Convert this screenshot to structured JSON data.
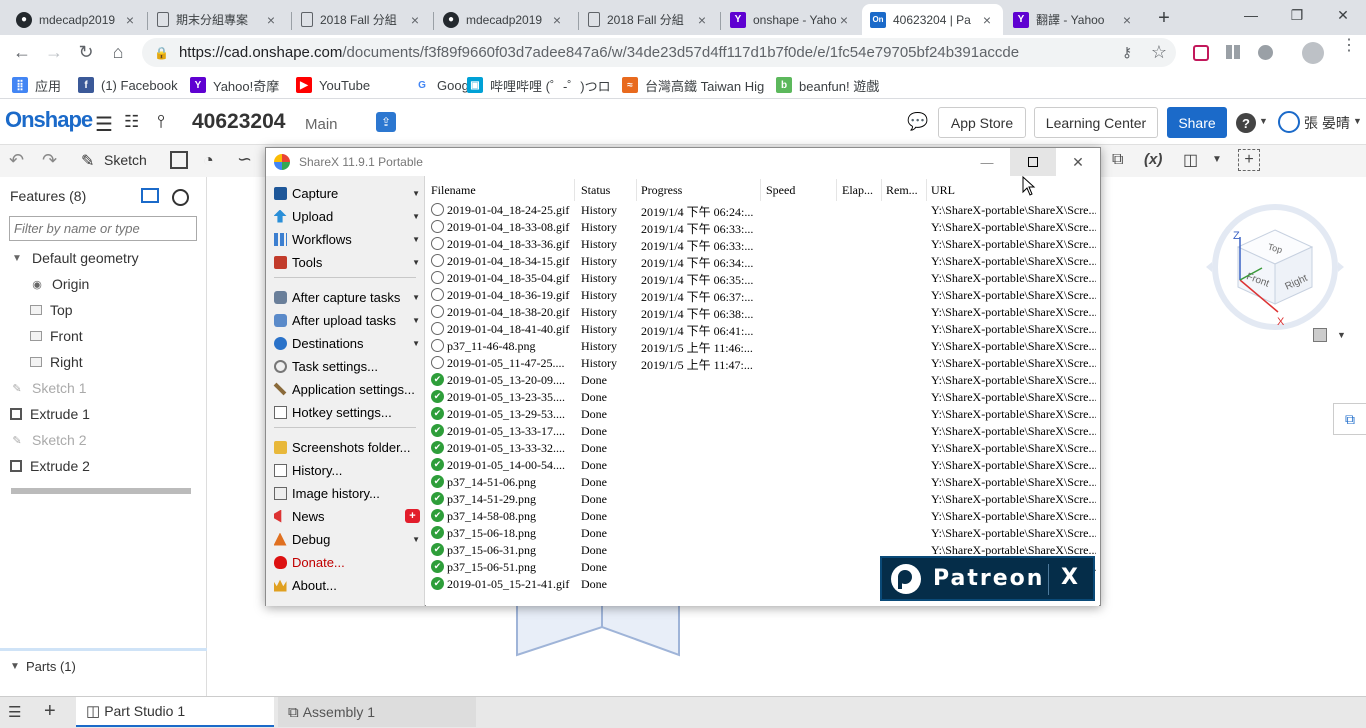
{
  "browser": {
    "tabs": [
      {
        "title": "mdecadp2019",
        "icon": "github-icon",
        "active": false
      },
      {
        "title": "期末分組專案",
        "icon": "doc-icon",
        "active": false
      },
      {
        "title": "2018 Fall 分組",
        "icon": "doc-icon",
        "active": false
      },
      {
        "title": "mdecadp2019",
        "icon": "github-icon",
        "active": false
      },
      {
        "title": "2018 Fall 分組",
        "icon": "doc-icon",
        "active": false
      },
      {
        "title": "onshape - Yahoo",
        "icon": "yahoo-icon",
        "active": false
      },
      {
        "title": "40623204 | Pa",
        "icon": "onshape-icon",
        "active": true
      },
      {
        "title": "翻譯 - Yahoo",
        "icon": "yahoo-icon",
        "active": false
      }
    ],
    "url_host": "https://cad.onshape.com",
    "url_path": "/documents/f3f89f9660f03d7adee847a6/w/34de23d57d4ff117d1b7f0de/e/1fc54e79705bf24b391accde",
    "bookmarks": [
      "应用",
      "(1) Facebook",
      "Yahoo!奇摩",
      "YouTube",
      "Google",
      "哔哩哔哩 (゜-゜)つロ",
      "台灣高鐵 Taiwan Hig",
      "beanfun! 遊戲"
    ]
  },
  "onshape": {
    "logo": "Onshape",
    "doc_name": "40623204",
    "branch": "Main",
    "app_store": "App Store",
    "learning_center": "Learning Center",
    "share": "Share",
    "user": "張 晏晴",
    "sketch": "Sketch",
    "fx": "(x)",
    "features_title": "Features (8)",
    "filter_placeholder": "Filter by name or type",
    "features": [
      {
        "label": "Default geometry",
        "icon": "chevron-down-icon",
        "indent": 0,
        "muted": false
      },
      {
        "label": "Origin",
        "icon": "origin-icon",
        "indent": 2,
        "muted": false
      },
      {
        "label": "Top",
        "icon": "plane-icon",
        "indent": 2,
        "muted": false
      },
      {
        "label": "Front",
        "icon": "plane-icon",
        "indent": 2,
        "muted": false
      },
      {
        "label": "Right",
        "icon": "plane-icon",
        "indent": 2,
        "muted": false
      },
      {
        "label": "Sketch 1",
        "icon": "sketch-icon",
        "indent": 1,
        "muted": true
      },
      {
        "label": "Extrude 1",
        "icon": "extrude-icon",
        "indent": 1,
        "muted": false
      },
      {
        "label": "Sketch 2",
        "icon": "sketch-icon",
        "indent": 1,
        "muted": true
      },
      {
        "label": "Extrude 2",
        "icon": "extrude-icon",
        "indent": 1,
        "muted": false
      }
    ],
    "parts": "Parts (1)",
    "tabs_bottom": [
      "Part Studio 1",
      "Assembly 1"
    ],
    "viewcube": {
      "top": "Top",
      "front": "Front",
      "right": "Right",
      "z": "Z",
      "x": "X"
    }
  },
  "sharex": {
    "title": "ShareX 11.9.1 Portable",
    "menu": [
      {
        "label": "Capture",
        "icon": "capture-icon",
        "arrow": true,
        "color": "#000"
      },
      {
        "label": "Upload",
        "icon": "upload-icon",
        "arrow": true,
        "color": "#000"
      },
      {
        "label": "Workflows",
        "icon": "workflows-icon",
        "arrow": true,
        "color": "#000"
      },
      {
        "label": "Tools",
        "icon": "tools-icon",
        "arrow": true,
        "color": "#000"
      },
      {
        "label": "After capture tasks",
        "icon": "after-capture-icon",
        "arrow": true,
        "color": "#000"
      },
      {
        "label": "After upload tasks",
        "icon": "after-upload-icon",
        "arrow": true,
        "color": "#000"
      },
      {
        "label": "Destinations",
        "icon": "destinations-icon",
        "arrow": true,
        "color": "#000"
      },
      {
        "label": "Task settings...",
        "icon": "task-settings-icon",
        "arrow": false,
        "color": "#000"
      },
      {
        "label": "Application settings...",
        "icon": "app-settings-icon",
        "arrow": false,
        "color": "#000"
      },
      {
        "label": "Hotkey settings...",
        "icon": "hotkey-icon",
        "arrow": false,
        "color": "#000"
      },
      {
        "label": "Screenshots folder...",
        "icon": "folder-icon",
        "arrow": false,
        "color": "#000"
      },
      {
        "label": "History...",
        "icon": "history-icon",
        "arrow": false,
        "color": "#000"
      },
      {
        "label": "Image history...",
        "icon": "image-history-icon",
        "arrow": false,
        "color": "#000"
      },
      {
        "label": "News",
        "icon": "news-icon",
        "arrow": false,
        "badge": "+",
        "color": "#000"
      },
      {
        "label": "Debug",
        "icon": "debug-icon",
        "arrow": true,
        "color": "#000"
      },
      {
        "label": "Donate...",
        "icon": "heart-icon",
        "arrow": false,
        "color": "#c00000"
      },
      {
        "label": "About...",
        "icon": "crown-icon",
        "arrow": false,
        "color": "#000"
      }
    ],
    "columns": [
      "Filename",
      "Status",
      "Progress",
      "Speed",
      "Elap...",
      "Rem...",
      "URL"
    ],
    "rows": [
      {
        "file": "2019-01-04_18-24-25.gif",
        "status": "History",
        "progress": "2019/1/4 下午 06:24:...",
        "url": "Y:\\ShareX-portable\\ShareX\\Scre...",
        "type": "hist"
      },
      {
        "file": "2019-01-04_18-33-08.gif",
        "status": "History",
        "progress": "2019/1/4 下午 06:33:...",
        "url": "Y:\\ShareX-portable\\ShareX\\Scre...",
        "type": "hist"
      },
      {
        "file": "2019-01-04_18-33-36.gif",
        "status": "History",
        "progress": "2019/1/4 下午 06:33:...",
        "url": "Y:\\ShareX-portable\\ShareX\\Scre...",
        "type": "hist"
      },
      {
        "file": "2019-01-04_18-34-15.gif",
        "status": "History",
        "progress": "2019/1/4 下午 06:34:...",
        "url": "Y:\\ShareX-portable\\ShareX\\Scre...",
        "type": "hist"
      },
      {
        "file": "2019-01-04_18-35-04.gif",
        "status": "History",
        "progress": "2019/1/4 下午 06:35:...",
        "url": "Y:\\ShareX-portable\\ShareX\\Scre...",
        "type": "hist"
      },
      {
        "file": "2019-01-04_18-36-19.gif",
        "status": "History",
        "progress": "2019/1/4 下午 06:37:...",
        "url": "Y:\\ShareX-portable\\ShareX\\Scre...",
        "type": "hist"
      },
      {
        "file": "2019-01-04_18-38-20.gif",
        "status": "History",
        "progress": "2019/1/4 下午 06:38:...",
        "url": "Y:\\ShareX-portable\\ShareX\\Scre...",
        "type": "hist"
      },
      {
        "file": "2019-01-04_18-41-40.gif",
        "status": "History",
        "progress": "2019/1/4 下午 06:41:...",
        "url": "Y:\\ShareX-portable\\ShareX\\Scre...",
        "type": "hist"
      },
      {
        "file": "p37_11-46-48.png",
        "status": "History",
        "progress": "2019/1/5 上午 11:46:...",
        "url": "Y:\\ShareX-portable\\ShareX\\Scre...",
        "type": "hist"
      },
      {
        "file": "2019-01-05_11-47-25....",
        "status": "History",
        "progress": "2019/1/5 上午 11:47:...",
        "url": "Y:\\ShareX-portable\\ShareX\\Scre...",
        "type": "hist"
      },
      {
        "file": "2019-01-05_13-20-09....",
        "status": "Done",
        "progress": "",
        "url": "Y:\\ShareX-portable\\ShareX\\Scre...",
        "type": "done"
      },
      {
        "file": "2019-01-05_13-23-35....",
        "status": "Done",
        "progress": "",
        "url": "Y:\\ShareX-portable\\ShareX\\Scre...",
        "type": "done"
      },
      {
        "file": "2019-01-05_13-29-53....",
        "status": "Done",
        "progress": "",
        "url": "Y:\\ShareX-portable\\ShareX\\Scre...",
        "type": "done"
      },
      {
        "file": "2019-01-05_13-33-17....",
        "status": "Done",
        "progress": "",
        "url": "Y:\\ShareX-portable\\ShareX\\Scre...",
        "type": "done"
      },
      {
        "file": "2019-01-05_13-33-32....",
        "status": "Done",
        "progress": "",
        "url": "Y:\\ShareX-portable\\ShareX\\Scre...",
        "type": "done"
      },
      {
        "file": "2019-01-05_14-00-54....",
        "status": "Done",
        "progress": "",
        "url": "Y:\\ShareX-portable\\ShareX\\Scre...",
        "type": "done"
      },
      {
        "file": "p37_14-51-06.png",
        "status": "Done",
        "progress": "",
        "url": "Y:\\ShareX-portable\\ShareX\\Scre...",
        "type": "done"
      },
      {
        "file": "p37_14-51-29.png",
        "status": "Done",
        "progress": "",
        "url": "Y:\\ShareX-portable\\ShareX\\Scre...",
        "type": "done"
      },
      {
        "file": "p37_14-58-08.png",
        "status": "Done",
        "progress": "",
        "url": "Y:\\ShareX-portable\\ShareX\\Scre...",
        "type": "done"
      },
      {
        "file": "p37_15-06-18.png",
        "status": "Done",
        "progress": "",
        "url": "Y:\\ShareX-portable\\ShareX\\Scre...",
        "type": "done"
      },
      {
        "file": "p37_15-06-31.png",
        "status": "Done",
        "progress": "",
        "url": "Y:\\ShareX-portable\\ShareX\\Scre...",
        "type": "done"
      },
      {
        "file": "p37_15-06-51.png",
        "status": "Done",
        "progress": "",
        "url": "Y:\\ShareX-portable\\ShareX\\Scre...",
        "type": "done"
      },
      {
        "file": "2019-01-05_15-21-41.gif",
        "status": "Done",
        "progress": "",
        "url": "",
        "type": "done"
      }
    ],
    "patreon": "Patreon",
    "patreon_close": "X"
  }
}
